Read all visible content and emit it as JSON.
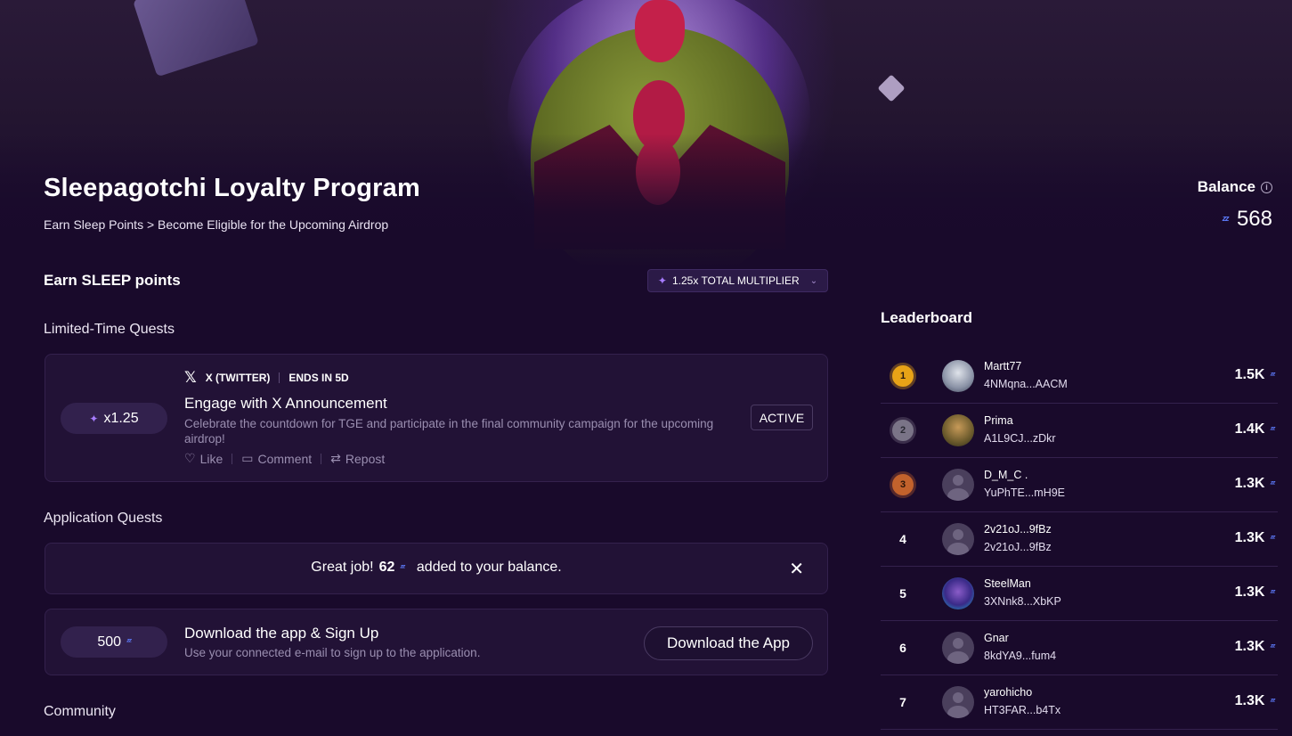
{
  "header": {
    "title": "Sleepagotchi Loyalty Program",
    "subtitle": "Earn Sleep Points > Become Eligible for the Upcoming Airdrop"
  },
  "balance": {
    "label": "Balance",
    "value": "568",
    "icon": "zzz-sleep-icon"
  },
  "earn": {
    "heading": "Earn SLEEP points",
    "multiplier_label": "1.25x TOTAL MULTIPLIER"
  },
  "limited_quests": {
    "heading": "Limited-Time Quests",
    "quest": {
      "multiplier": "x1.25",
      "platform": "X (TWITTER)",
      "ends": "ENDS IN 5D",
      "title": "Engage with X Announcement",
      "description": "Celebrate the countdown for TGE and participate in the final community campaign for the upcoming airdrop!",
      "actions": [
        "Like",
        "Comment",
        "Repost"
      ],
      "status": "ACTIVE"
    }
  },
  "application_quests": {
    "heading": "Application Quests",
    "toast": {
      "prefix": "Great job!",
      "amount": "62",
      "suffix": "added to your balance."
    },
    "quest": {
      "points": "500",
      "title": "Download the app & Sign Up",
      "description": "Use your connected e-mail to sign up to the application.",
      "button": "Download the App"
    }
  },
  "community": {
    "heading": "Community"
  },
  "leaderboard": {
    "title": "Leaderboard",
    "rows": [
      {
        "rank": "1",
        "name": "Martt77",
        "address": "4NMqna...AACM",
        "score": "1.5K"
      },
      {
        "rank": "2",
        "name": "Prima",
        "address": "A1L9CJ...zDkr",
        "score": "1.4K"
      },
      {
        "rank": "3",
        "name": "D_M_C .",
        "address": "YuPhTE...mH9E",
        "score": "1.3K"
      },
      {
        "rank": "4",
        "name": "2v21oJ...9fBz",
        "address": "2v21oJ...9fBz",
        "score": "1.3K"
      },
      {
        "rank": "5",
        "name": "SteelMan",
        "address": "3XNnk8...XbKP",
        "score": "1.3K"
      },
      {
        "rank": "6",
        "name": "Gnar",
        "address": "8kdYA9...fum4",
        "score": "1.3K"
      },
      {
        "rank": "7",
        "name": "yarohicho",
        "address": "HT3FAR...b4Tx",
        "score": "1.3K"
      }
    ]
  },
  "colors": {
    "background": "#190a2b",
    "card": "#221236",
    "accent": "#5e7dff",
    "gold": "#e8a317",
    "silver": "#7a7487",
    "bronze": "#c2622c"
  }
}
